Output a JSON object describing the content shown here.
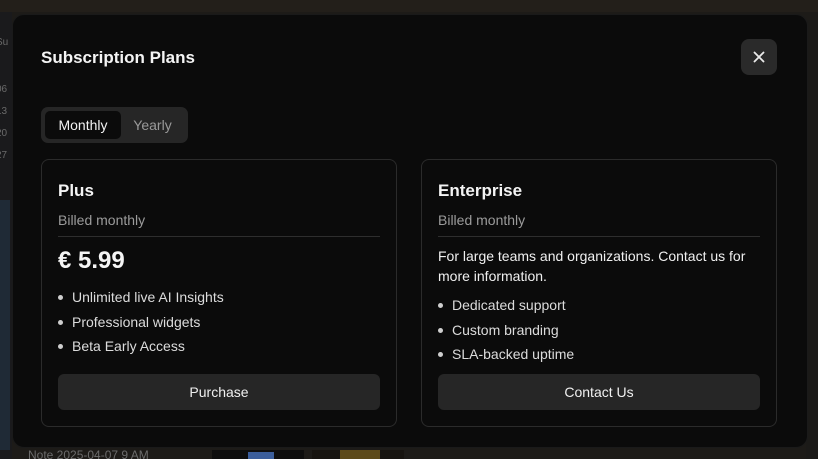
{
  "background": {
    "left_fragments": [
      "Su",
      "06",
      "13",
      "20",
      "27"
    ],
    "bottom_fragment": "Note 2025-04-07 9 AM"
  },
  "modal": {
    "title": "Subscription Plans",
    "close_icon": "close-icon",
    "billing_toggle": {
      "options": [
        "Monthly",
        "Yearly"
      ],
      "selected": "Monthly"
    }
  },
  "plans": {
    "plus": {
      "name": "Plus",
      "billing": "Billed monthly",
      "price": "€ 5.99",
      "features": [
        "Unlimited live AI Insights",
        "Professional widgets",
        "Beta Early Access"
      ],
      "button": "Purchase"
    },
    "enterprise": {
      "name": "Enterprise",
      "billing": "Billed monthly",
      "description": "For large teams and organizations. Contact us for more information.",
      "features": [
        "Dedicated support",
        "Custom branding",
        "SLA-backed uptime"
      ],
      "button": "Contact Us"
    }
  },
  "colors": {
    "modal_bg": "#0b0b0b",
    "button_bg": "#262626",
    "border": "#2b2b2b",
    "muted_text": "#9b9b9b"
  }
}
